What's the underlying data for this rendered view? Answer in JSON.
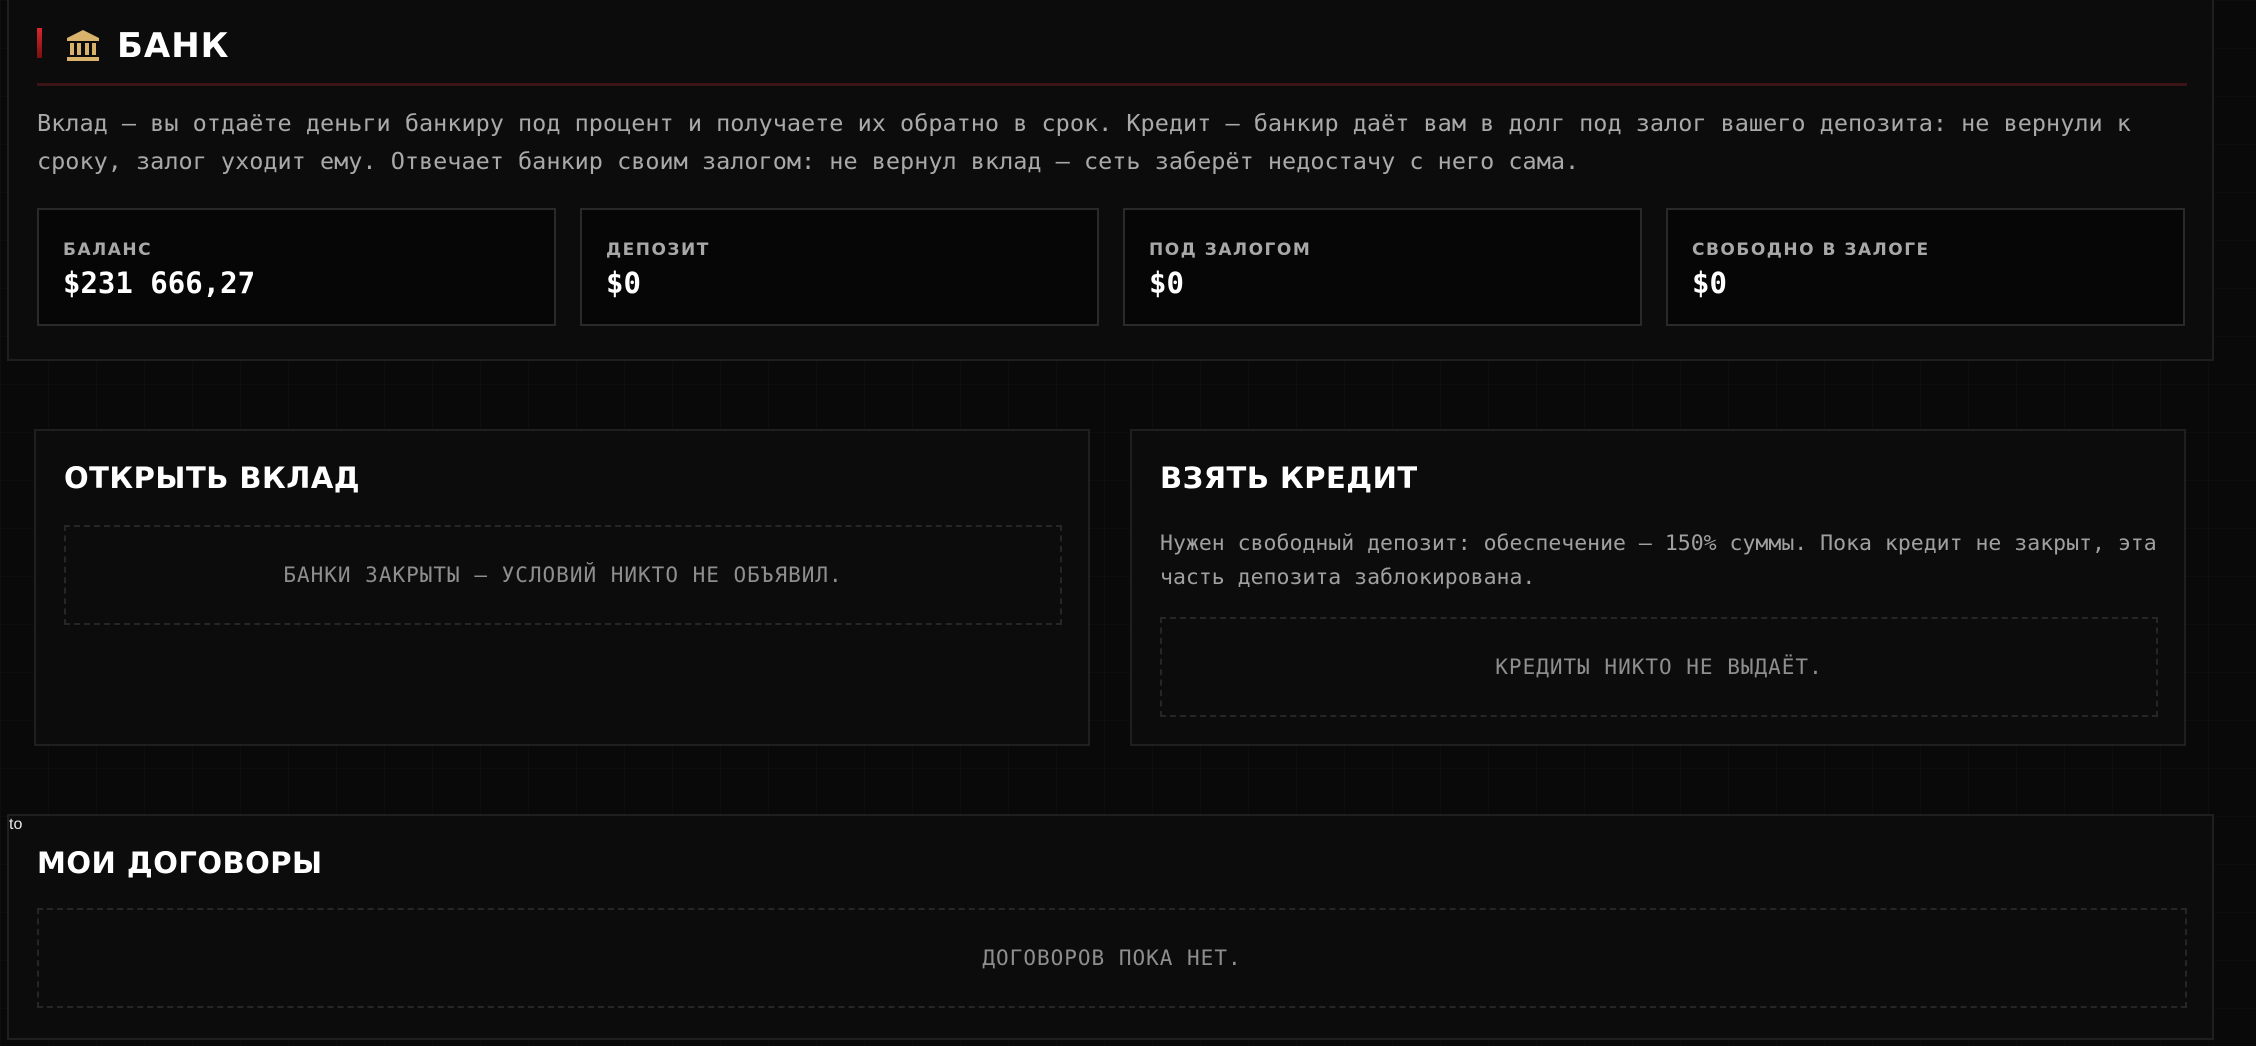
{
  "bank": {
    "title": "БАНК",
    "icon": "bank-building-icon",
    "description": "Вклад — вы отдаёте деньги банкиру под процент и получаете их обратно в срок. Кредит — банкир даёт вам в долг под залог вашего депозита: не вернули к сроку, залог уходит ему. Отвечает банкир своим залогом: не вернул вклад — сеть заберёт недостачу с него сама.",
    "stats": [
      {
        "label": "БАЛАНС",
        "value": "$231 666,27"
      },
      {
        "label": "ДЕПОЗИТ",
        "value": "$0"
      },
      {
        "label": "ПОД ЗАЛОГОМ",
        "value": "$0"
      },
      {
        "label": "СВОБОДНО В ЗАЛОГЕ",
        "value": "$0"
      }
    ]
  },
  "deposit": {
    "title": "ОТКРЫТЬ ВКЛАД",
    "empty_text": "Банки закрыты — условий никто не объявил."
  },
  "credit": {
    "title": "ВЗЯТЬ КРЕДИТ",
    "description": "Нужен свободный депозит: обеспечение — 150% суммы. Пока кредит не закрыт, эта часть депозита заблокирована.",
    "empty_text": "Кредиты никто не выдаёт."
  },
  "contracts": {
    "title": "МОИ ДОГОВОРЫ",
    "empty_text": "Договоров пока нет."
  },
  "colors": {
    "accent": "#d8282e",
    "gold_icon": "#d9b36c",
    "background": "#090909"
  }
}
